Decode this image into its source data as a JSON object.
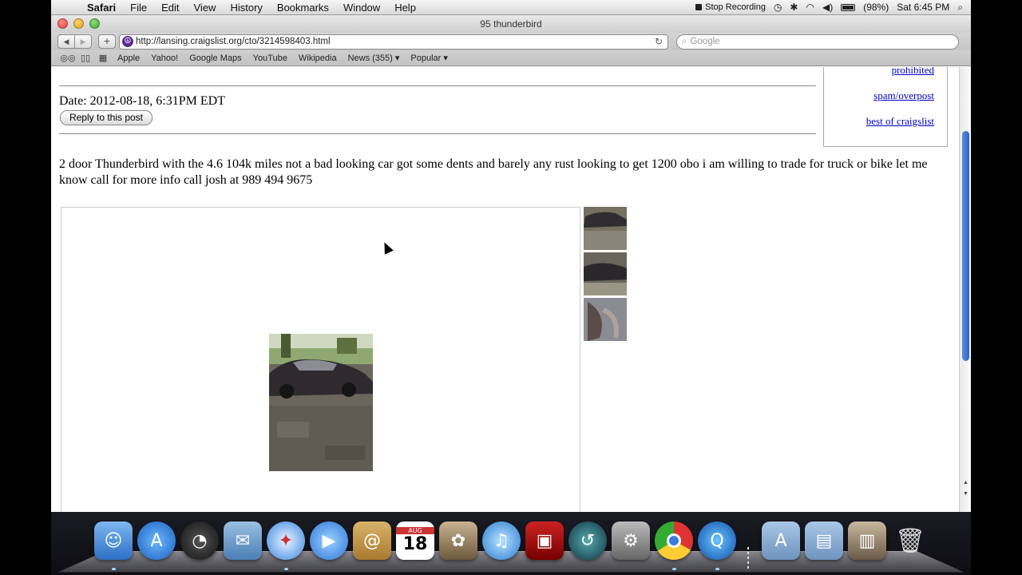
{
  "menubar": {
    "app_name": "Safari",
    "menus": [
      "File",
      "Edit",
      "View",
      "History",
      "Bookmarks",
      "Window",
      "Help"
    ],
    "stop_recording": "Stop Recording",
    "battery": "(98%)",
    "clock": "Sat 6:45 PM"
  },
  "window": {
    "title": "95 thunderbird",
    "url": "http://lansing.craigslist.org/cto/3214598403.html",
    "search_placeholder": "Google"
  },
  "bookmarks": [
    "Apple",
    "Yahoo!",
    "Google Maps",
    "YouTube",
    "Wikipedia",
    "News (355)",
    "Popular"
  ],
  "post": {
    "date": "Date: 2012-08-18, 6:31PM EDT",
    "reply_button": "Reply to this post",
    "body": "2 door Thunderbird with the 4.6 104k miles not a bad looking car got some dents and barely any rust looking to get 1200 obo i am willing to trade for truck or bike let me know call for more info call josh at 989 494 9675"
  },
  "sidebar_links": [
    "prohibited",
    "spam/overpost",
    "best of craigslist"
  ],
  "dock": {
    "calendar_month": "AUG",
    "calendar_day": "18"
  }
}
